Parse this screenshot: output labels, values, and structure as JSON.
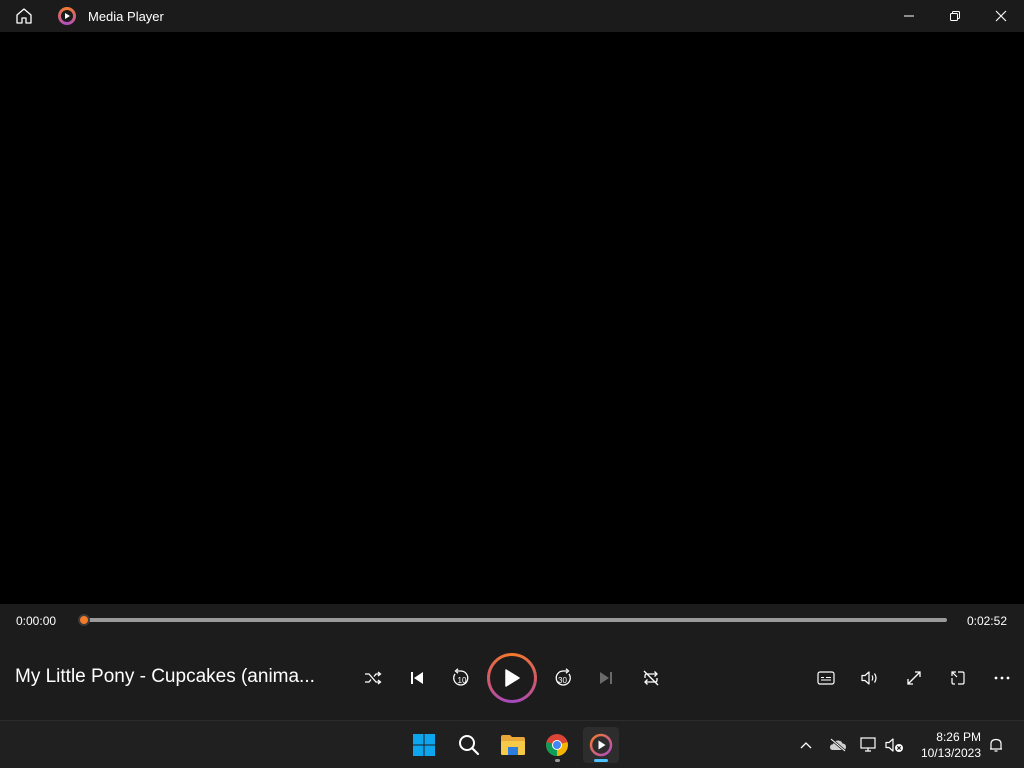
{
  "window": {
    "title": "Media Player",
    "buttons": [
      "minimize",
      "restore",
      "close"
    ]
  },
  "player": {
    "current_time": "0:00:00",
    "duration": "0:02:52",
    "progress": 0.0,
    "media_title": "My Little Pony - Cupcakes (anima...",
    "state": "paused"
  },
  "controls": {
    "left": [
      "shuffle-icon",
      "previous-icon",
      "skip-back-10-icon",
      "play-icon",
      "skip-forward-30-icon",
      "next-icon",
      "repeat-off-icon"
    ],
    "skip_back_label": "10",
    "skip_forward_label": "30",
    "right": [
      "captions-icon",
      "volume-icon",
      "fullscreen-icon",
      "mini-player-icon",
      "more-icon"
    ]
  },
  "taskbar": {
    "apps": [
      "windows-start-icon",
      "search-icon",
      "file-explorer-icon",
      "chrome-icon",
      "media-player-icon"
    ],
    "time": "8:26 PM",
    "date": "10/13/2023"
  },
  "colors": {
    "accent": "#f47b2a",
    "accent2": "#b14cc4",
    "taskbar_active": "#4cc2ff"
  }
}
